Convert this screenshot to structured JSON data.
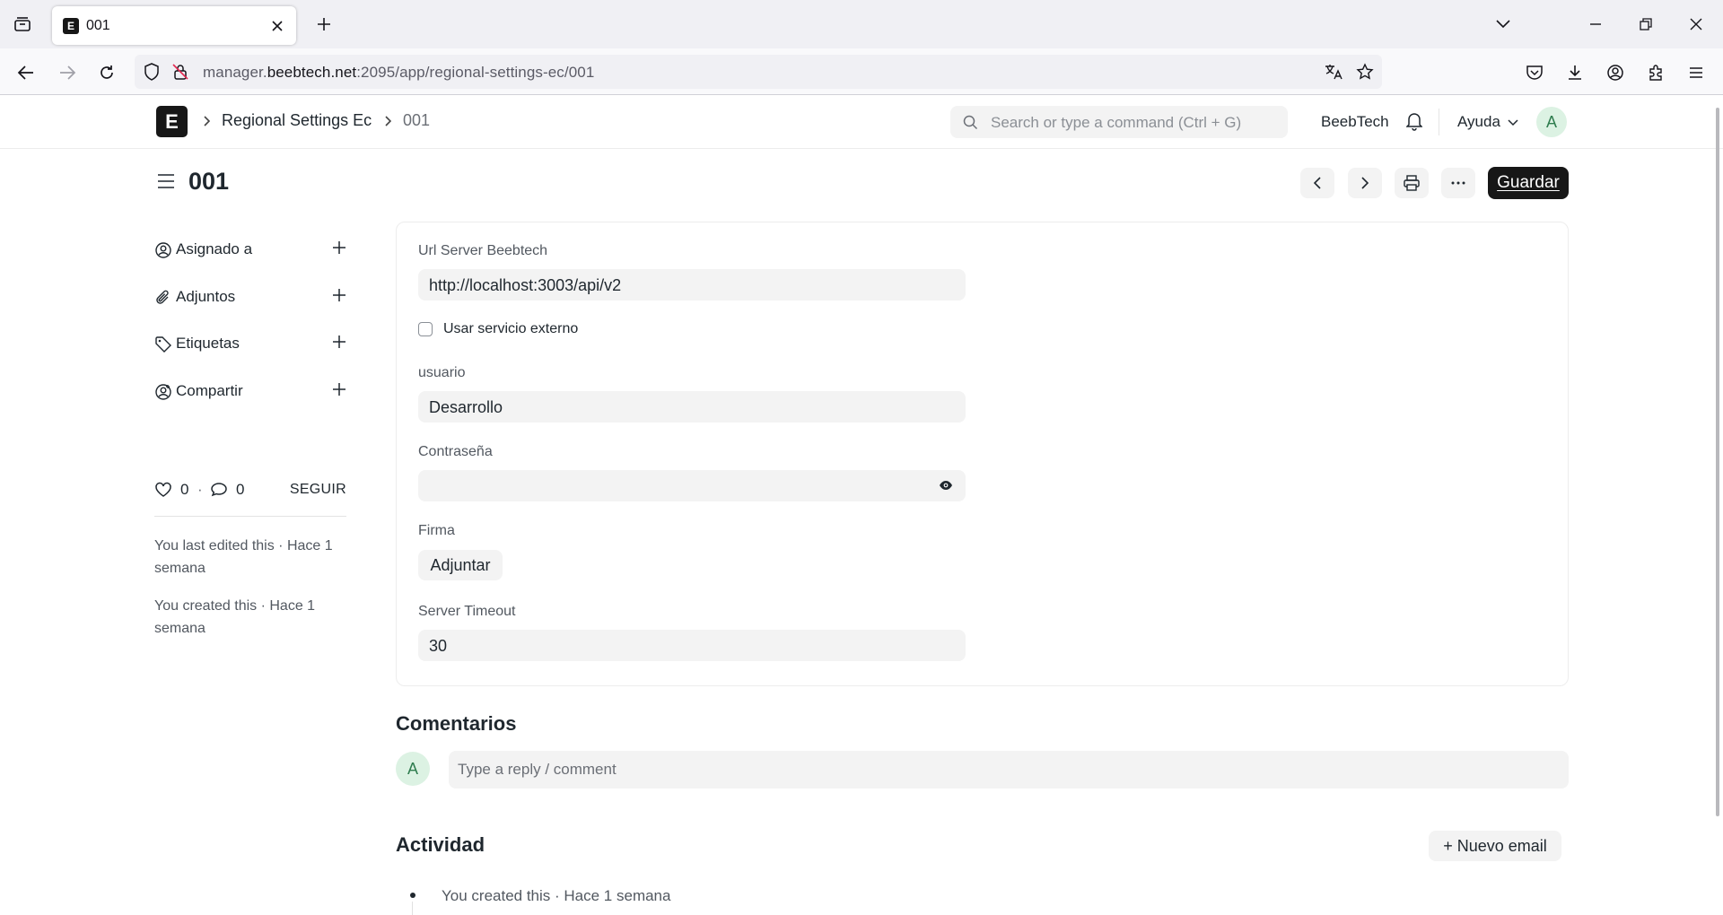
{
  "browser": {
    "tab_title": "001",
    "url_host_prefix": "manager.",
    "url_host_main": "beebtech.net",
    "url_rest": ":2095/app/regional-settings-ec/001"
  },
  "header": {
    "logo_letter": "E",
    "breadcrumb_doctype": "Regional Settings Ec",
    "breadcrumb_record": "001",
    "search_placeholder": "Search or type a command (Ctrl + G)",
    "company": "BeebTech",
    "help_label": "Ayuda",
    "avatar_letter": "A"
  },
  "page": {
    "title": "001",
    "save_label": "Guardar"
  },
  "sidebar": {
    "items": [
      {
        "label": "Asignado a",
        "icon": "assign-icon"
      },
      {
        "label": "Adjuntos",
        "icon": "paperclip-icon"
      },
      {
        "label": "Etiquetas",
        "icon": "tag-icon"
      },
      {
        "label": "Compartir",
        "icon": "share-user-icon"
      }
    ],
    "likes": "0",
    "comments": "0",
    "dot": "·",
    "follow_label": "SEGUIR",
    "last_edited": "You last edited this · Hace 1 semana",
    "created": "You created this · Hace 1 semana"
  },
  "form": {
    "url_label": "Url Server Beebtech",
    "url_value": "http://localhost:3003/api/v2",
    "external_label": "Usar servicio externo",
    "external_checked": false,
    "user_label": "usuario",
    "user_value": "Desarrollo",
    "password_label": "Contraseña",
    "password_value": "",
    "signature_label": "Firma",
    "attach_label": "Adjuntar",
    "timeout_label": "Server Timeout",
    "timeout_value": "30"
  },
  "comments": {
    "title": "Comentarios",
    "avatar_letter": "A",
    "placeholder": "Type a reply / comment"
  },
  "activity": {
    "title": "Actividad",
    "new_email_label": "+ Nuevo email",
    "items": [
      "You created this · Hace 1 semana"
    ]
  }
}
